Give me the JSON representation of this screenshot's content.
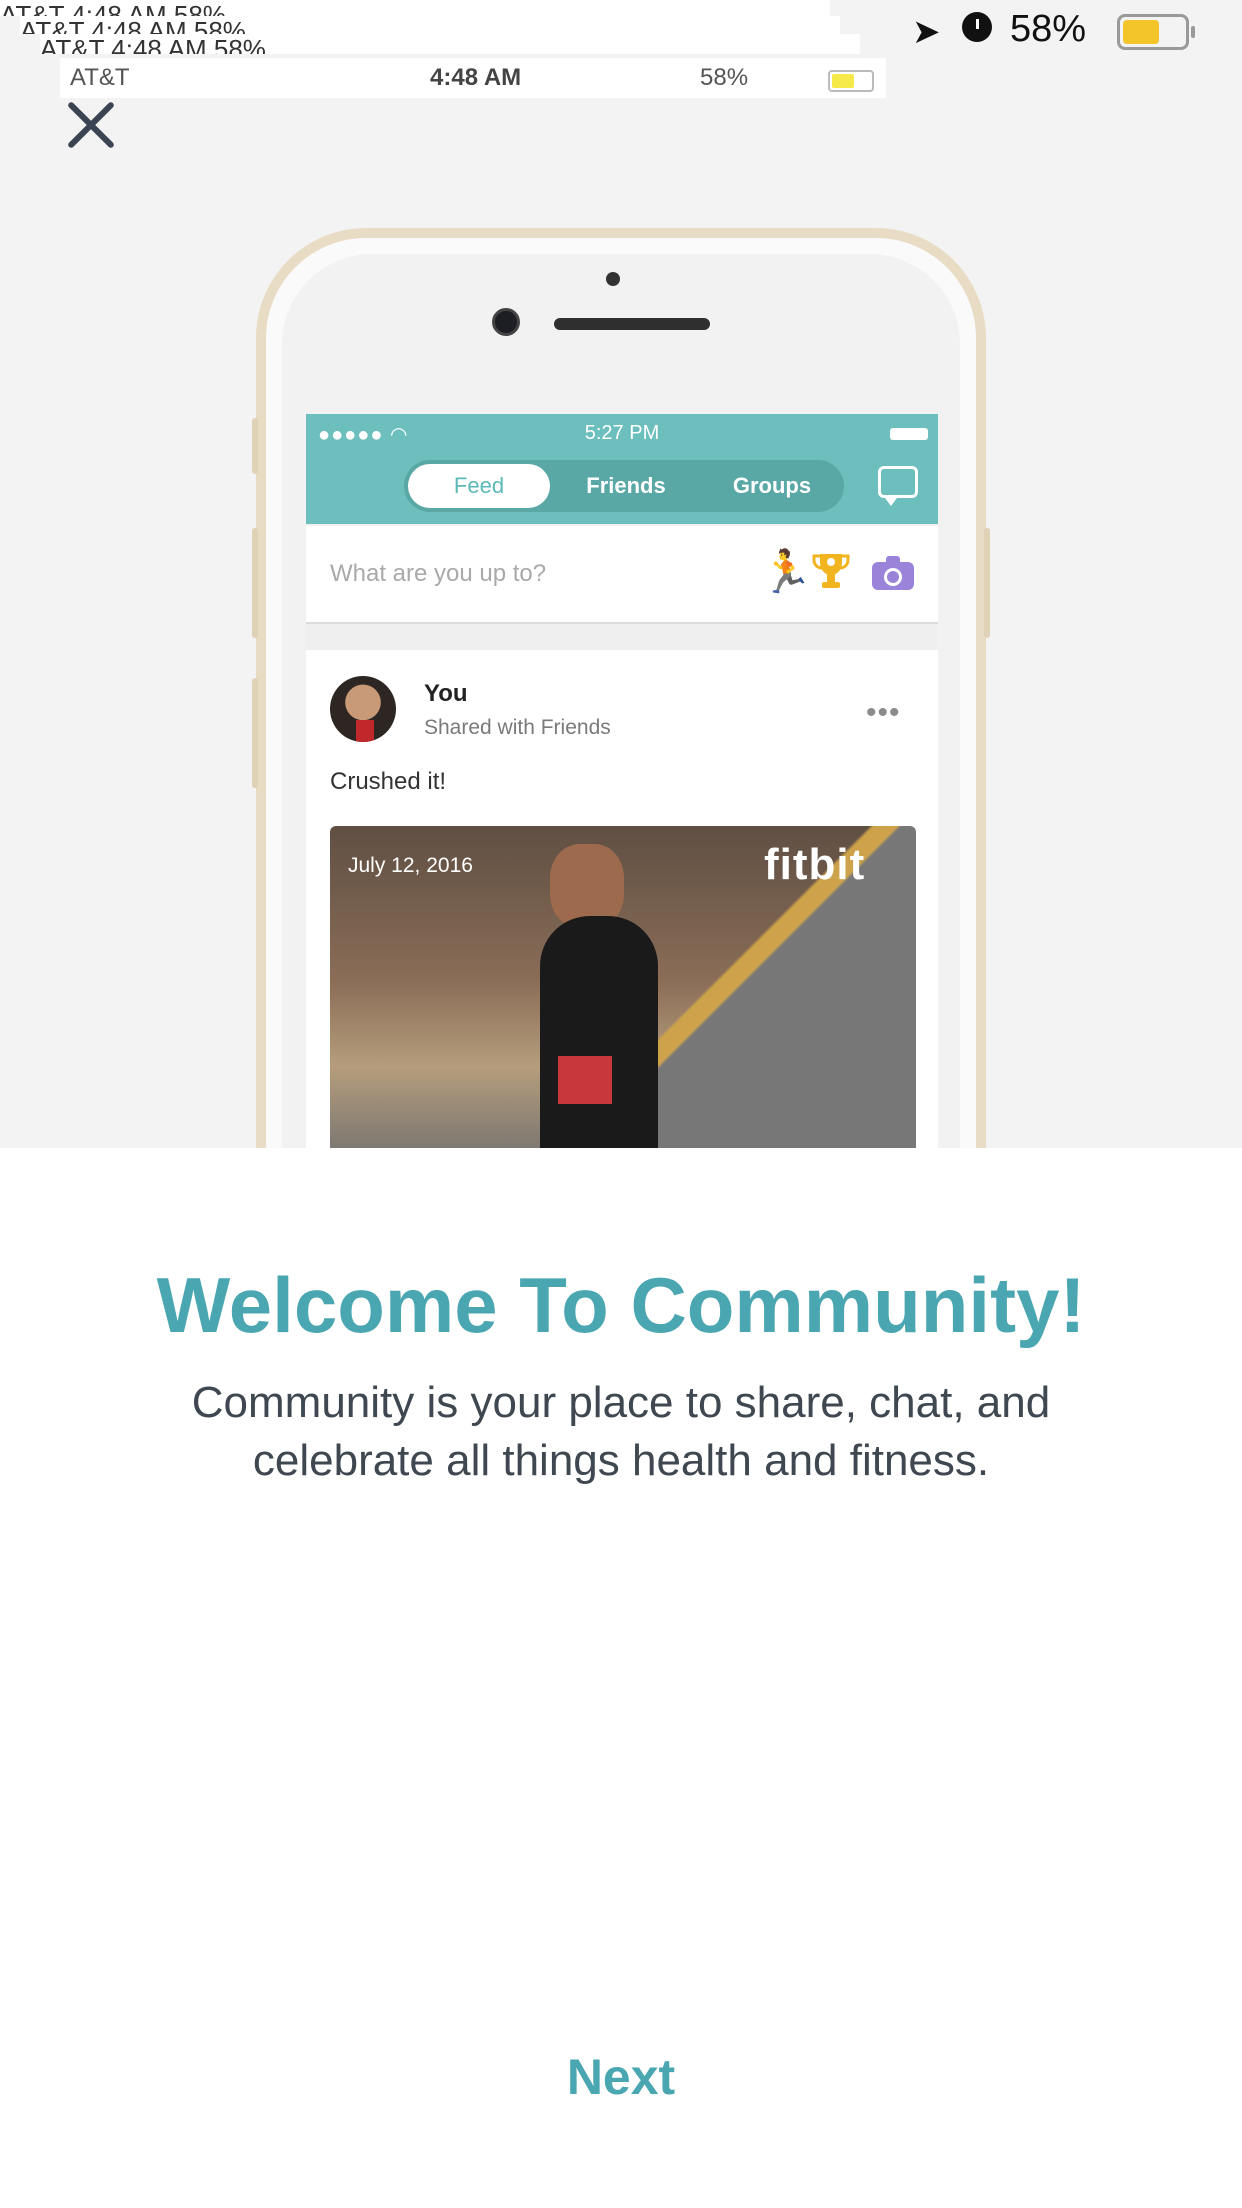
{
  "statusbar": {
    "glitch_text": "AT&T    4:48 AM    58%",
    "carrier": "AT&T",
    "time": "4:48 AM",
    "right_text": "58%",
    "battery_percent": "58%",
    "icon_location": "location-arrow-icon",
    "icon_alarm": "alarm-icon"
  },
  "close": {
    "icon": "close-icon"
  },
  "app_preview": {
    "status_time": "5:27 PM",
    "tabs": [
      {
        "label": "Feed",
        "active": true
      },
      {
        "label": "Friends",
        "active": false
      },
      {
        "label": "Groups",
        "active": false
      }
    ],
    "post_placeholder": "What are you up to?",
    "post": {
      "author": "You",
      "visibility": "Shared with Friends",
      "caption": "Crushed it!",
      "photo_date": "July 12, 2016",
      "brand": "fitbit"
    }
  },
  "welcome": {
    "title": "Welcome To Community!",
    "description": "Community is your place to share, chat, and\ncelebrate all things health and fitness."
  },
  "actions": {
    "next": "Next"
  },
  "colors": {
    "teal_accent": "#4aa7b1",
    "header_teal": "#6dbfbe",
    "text_dark": "#3f4751",
    "battery_yellow": "#f4c42b"
  }
}
